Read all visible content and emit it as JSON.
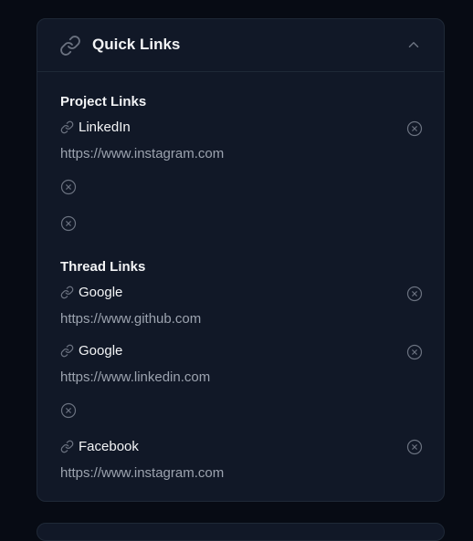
{
  "panel": {
    "title": "Quick Links",
    "title_icon": "link-icon",
    "collapse_icon": "chevron-up-icon"
  },
  "project_links": {
    "title": "Project Links",
    "items": [
      {
        "label": "LinkedIn",
        "url": "https://www.instagram.com"
      }
    ]
  },
  "thread_links": {
    "title": "Thread Links",
    "items": [
      {
        "label": "Google",
        "url": "https://www.github.com"
      },
      {
        "label": "Google",
        "url": "https://www.linkedin.com"
      },
      {
        "label": "Facebook",
        "url": "https://www.instagram.com"
      }
    ]
  },
  "colors": {
    "background": "#070b14",
    "panel": "#111827",
    "border": "#1f2937",
    "text": "#f3f4f6",
    "muted": "#9ca3af",
    "icon": "#6b7280"
  }
}
